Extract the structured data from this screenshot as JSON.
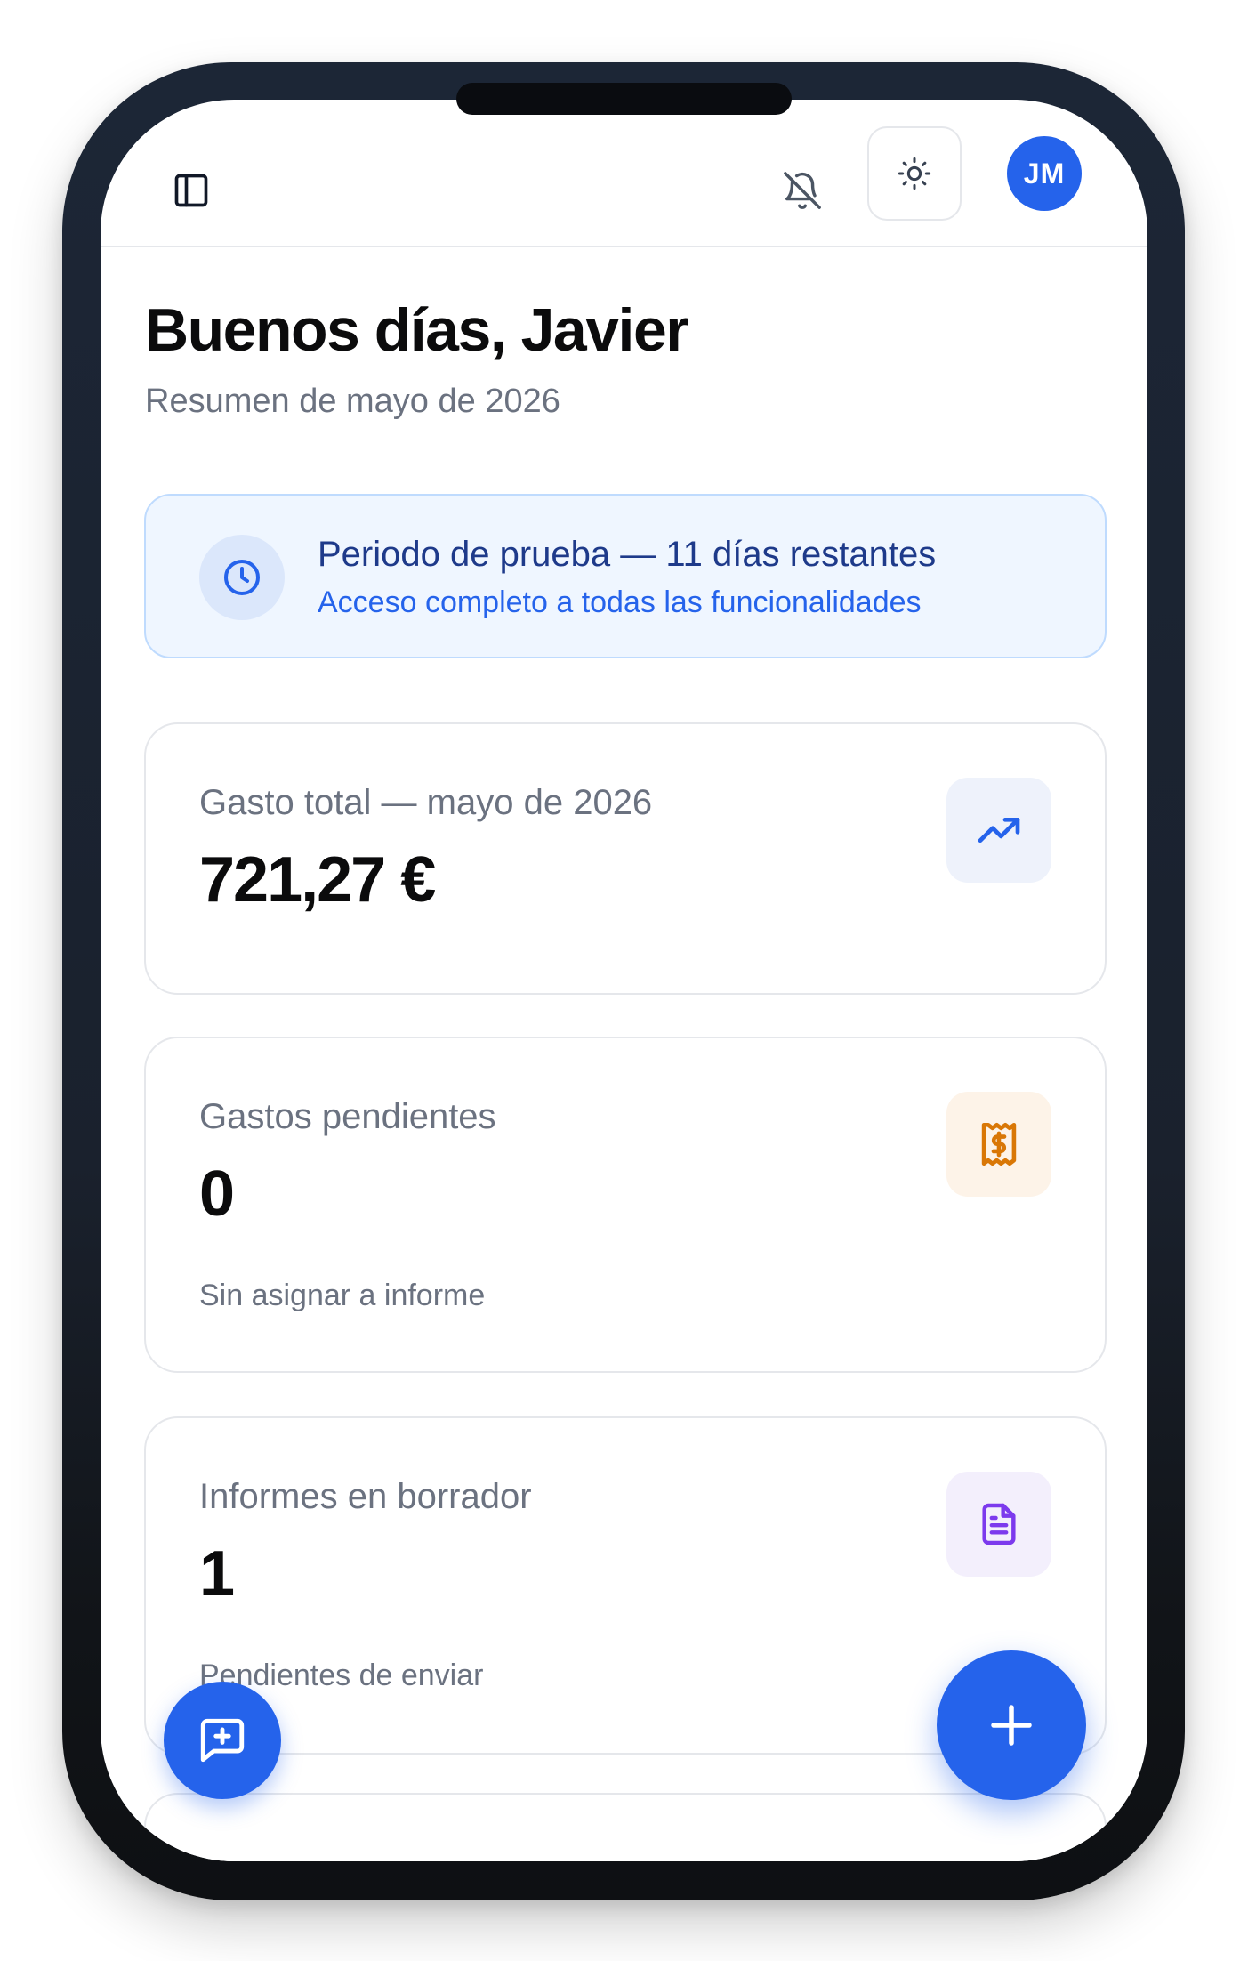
{
  "header": {
    "avatar_initials": "JM",
    "icons": [
      "sidebar-toggle-icon",
      "bell-off-icon",
      "sun-icon"
    ]
  },
  "greeting": {
    "title": "Buenos días, Javier",
    "subtitle": "Resumen de mayo de 2026"
  },
  "trial": {
    "title": "Periodo de prueba — 11 días restantes",
    "subtitle": "Acceso completo a todas las funcionalidades",
    "icon": "clock-icon"
  },
  "cards": [
    {
      "label": "Gasto total — mayo de 2026",
      "value": "721,27 €",
      "icon": "trending-up-icon",
      "icon_color": "#2563eb",
      "icon_bg": "#eef2fb"
    },
    {
      "label": "Gastos pendientes",
      "value": "0",
      "note": "Sin asignar a informe",
      "icon": "receipt-dollar-icon",
      "icon_color": "#d97706",
      "icon_bg": "#fdf3e8"
    },
    {
      "label": "Informes en borrador",
      "value": "1",
      "note": "Pendientes de enviar",
      "icon": "document-icon",
      "icon_color": "#7c3aed",
      "icon_bg": "#f3effc"
    }
  ],
  "fabs": {
    "chat_icon": "message-plus-icon",
    "add_icon": "plus-icon"
  },
  "colors": {
    "accent": "#2563eb",
    "trial_bg": "#eff6ff",
    "trial_border": "#bfdbfe",
    "text_primary": "#0b0b0c",
    "text_muted": "#6b7280"
  }
}
